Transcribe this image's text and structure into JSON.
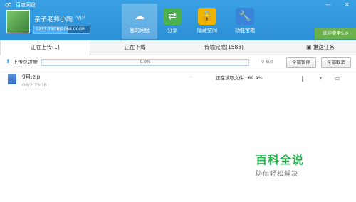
{
  "app": {
    "title": "百度网盘"
  },
  "window_controls": {
    "minimize": "—",
    "close": "✕"
  },
  "user": {
    "name": "亲子老师小陶",
    "vip_badge": "VIP",
    "quota": "1233.75GB/2068.00GB",
    "quota_used_fraction": 0.6
  },
  "nav": [
    {
      "label": "我的网盘",
      "icon": "cloud-icon",
      "glyph": "☁",
      "color": "#ffffff",
      "active": true
    },
    {
      "label": "分享",
      "icon": "share-icon",
      "glyph": "⇄",
      "color": "#4caf50",
      "active": false
    },
    {
      "label": "隐藏空间",
      "icon": "lock-icon",
      "glyph": "🔒",
      "color": "#f0b400",
      "active": false
    },
    {
      "label": "功能宝箱",
      "icon": "toolbox-icon",
      "glyph": "🔧",
      "color": "#3a83d8",
      "active": false
    }
  ],
  "upgrade_label": "欢迎使用5.0",
  "tabs": [
    {
      "label": "正在上传(1)",
      "active": true
    },
    {
      "label": "正在下载",
      "active": false
    },
    {
      "label": "传输完成(1583)",
      "active": false
    },
    {
      "label": "推送任务",
      "active": false
    }
  ],
  "total_progress": {
    "label": "上传总进度",
    "percent_text": "0.0%",
    "speed": "0 B/s"
  },
  "buttons": {
    "pause_all": "全部暂停",
    "cancel_all": "全部取消"
  },
  "file": {
    "name": "9月.zip",
    "size": "0B/2.75GB",
    "dots": "...",
    "status": "正在读取文件...69.4%"
  },
  "row_controls": {
    "pause": "‖",
    "cancel": "✕",
    "folder": "▭"
  },
  "watermark": {
    "title": "百科全说",
    "subtitle": "助你轻松解决"
  },
  "colors": {
    "header": "#2c8fd6",
    "accent": "#3a9be0",
    "green": "#20b24a"
  }
}
